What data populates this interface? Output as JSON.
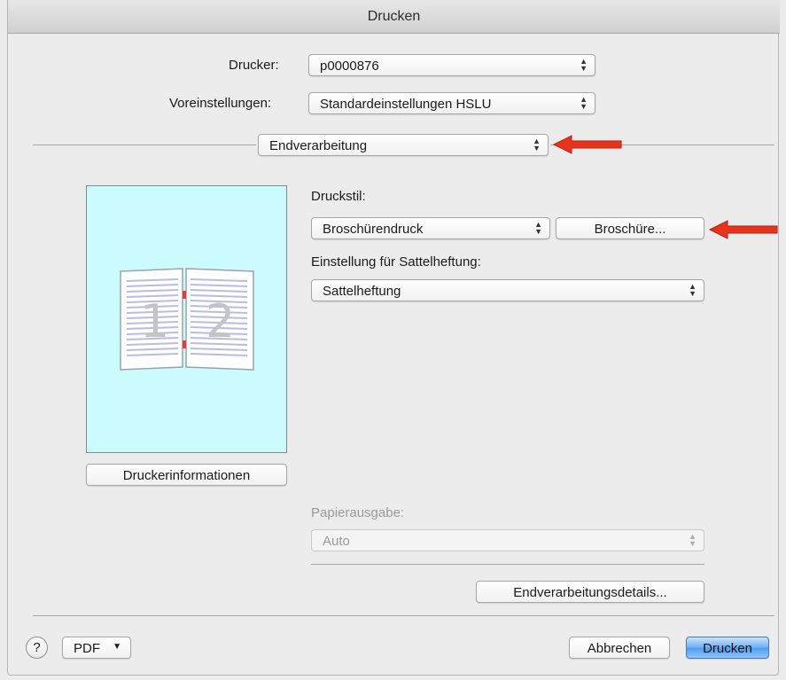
{
  "window": {
    "title": "Drucken"
  },
  "printer": {
    "label": "Drucker:",
    "value": "p0000876"
  },
  "presets": {
    "label": "Voreinstellungen:",
    "value": "Standardeinstellungen HSLU"
  },
  "section_popup": {
    "value": "Endverarbeitung"
  },
  "druckstil": {
    "label": "Druckstil:",
    "value": "Broschürendruck",
    "booklet_button": "Broschüre..."
  },
  "saddle": {
    "label": "Einstellung für Sattelheftung:",
    "value": "Sattelheftung"
  },
  "preview": {
    "page_left": "1",
    "page_right": "2"
  },
  "printer_info_button": "Druckerinformationen",
  "output": {
    "label": "Papierausgabe:",
    "value": "Auto"
  },
  "finishing_details_button": "Endverarbeitungsdetails...",
  "footer": {
    "help": "?",
    "pdf": "PDF",
    "cancel": "Abbrechen",
    "print": "Drucken"
  },
  "colors": {
    "annotation_arrow": "#e8331c",
    "preview_bg": "#ccfbfe",
    "default_button": "#4f9bef"
  }
}
